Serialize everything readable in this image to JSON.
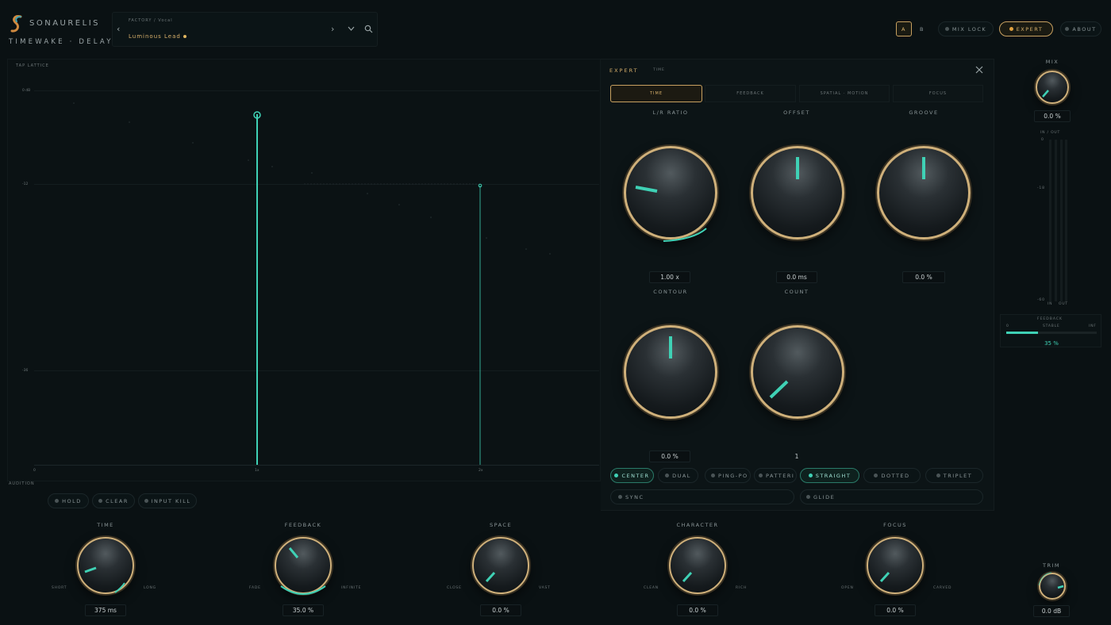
{
  "header": {
    "brand": "SONAURELIS",
    "product": "TIMEWAKE · DELAY",
    "preset_category": "FACTORY / Vocal",
    "preset_name": "Luminous Lead",
    "buttons": {
      "a": "A",
      "b": "B",
      "mix_lock": "MIX LOCK",
      "expert": "EXPERT",
      "about": "ABOUT"
    }
  },
  "tap_lattice": {
    "title": "TAP LATTICE",
    "db_labels": [
      "0 dB",
      "-12",
      "-36"
    ],
    "x_labels": [
      "0",
      "1x",
      "2x"
    ],
    "audition": "AUDITION"
  },
  "actions": {
    "hold": "HOLD",
    "clear": "CLEAR",
    "input_kill": "INPUT KILL"
  },
  "expert": {
    "title": "EXPERT",
    "subtitle": "TIME",
    "tabs": [
      "TIME",
      "FEEDBACK",
      "SPATIAL · MOTION",
      "FOCUS"
    ],
    "knobs": [
      {
        "label": "L/R RATIO",
        "value": "1.00 x"
      },
      {
        "label": "OFFSET",
        "value": "0.0 ms"
      },
      {
        "label": "GROOVE",
        "value": "0.0 %"
      },
      {
        "label": "CONTOUR",
        "value": "0.0 %"
      },
      {
        "label": "COUNT",
        "value": "1"
      }
    ],
    "modes": [
      "CENTER",
      "DUAL",
      "PING-PO",
      "PATTERI",
      "STRAIGHT",
      "DOTTED",
      "TRIPLET"
    ],
    "sync": "SYNC",
    "glide": "GLIDE"
  },
  "right": {
    "mix_label": "MIX",
    "mix_value": "0.0 %",
    "meter_label": "IN / OUT",
    "meter_scale": [
      "0",
      "-18",
      "-60"
    ],
    "meter_in": "IN",
    "meter_out": "OUT",
    "fb_title": "FEEDBACK",
    "fb_scale": [
      "0",
      "STABLE",
      "INF"
    ],
    "fb_value": "35 %",
    "trim_label": "TRIM",
    "trim_value": "0.0 dB"
  },
  "main_knobs": [
    {
      "label": "TIME",
      "left": "SHORT",
      "right": "LONG",
      "value": "375 ms"
    },
    {
      "label": "FEEDBACK",
      "left": "FADE",
      "right": "INFINITE",
      "value": "35.0 %"
    },
    {
      "label": "SPACE",
      "left": "CLOSE",
      "right": "VAST",
      "value": "0.0 %"
    },
    {
      "label": "CHARACTER",
      "left": "CLEAN",
      "right": "RICH",
      "value": "0.0 %"
    },
    {
      "label": "FOCUS",
      "left": "OPEN",
      "right": "CARVED",
      "value": "0.0 %"
    }
  ],
  "colors": {
    "accent": "#3fd1b5",
    "gold": "#d8b06b"
  }
}
